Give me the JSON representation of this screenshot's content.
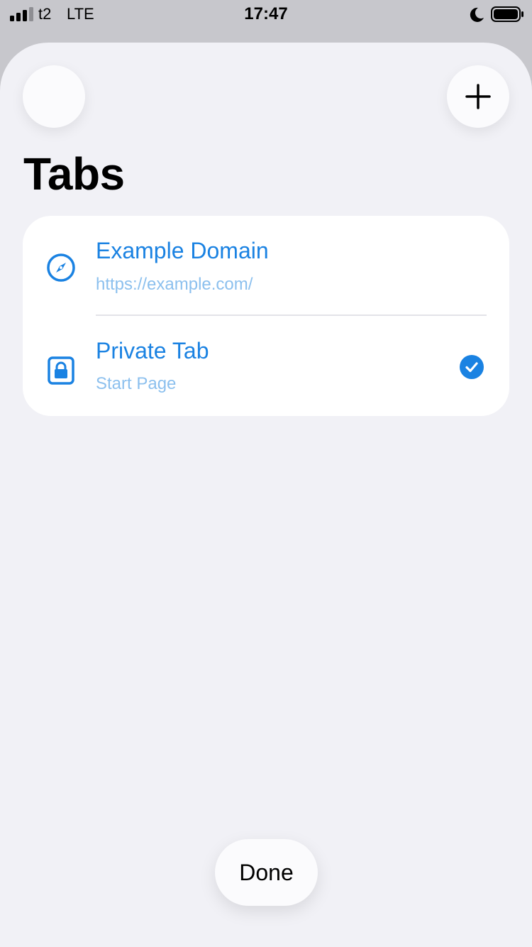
{
  "status_bar": {
    "carrier": "t2",
    "network": "LTE",
    "time": "17:47"
  },
  "header": {
    "title": "Tabs",
    "add_icon": "plus-icon"
  },
  "tabs": [
    {
      "title": "Example Domain",
      "subtitle": "https://example.com/",
      "icon": "compass-icon",
      "selected": false
    },
    {
      "title": "Private Tab",
      "subtitle": "Start Page",
      "icon": "lock-icon",
      "selected": true
    }
  ],
  "footer": {
    "done_label": "Done"
  },
  "colors": {
    "accent": "#1a82e2",
    "subtitle": "#8cc0ee",
    "sheet_background": "#f1f1f6"
  }
}
